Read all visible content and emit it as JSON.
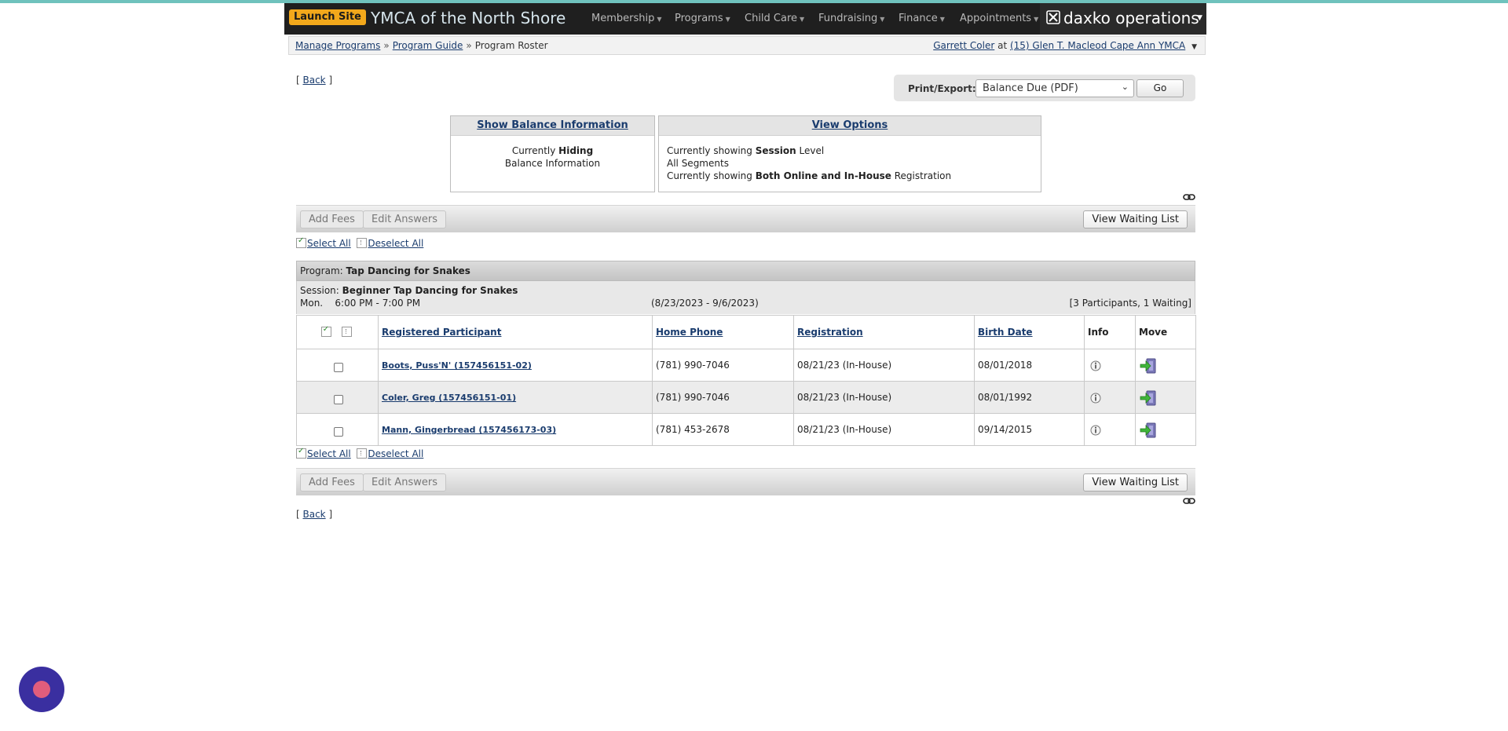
{
  "header": {
    "launch_label": "Launch Site",
    "org_name": "YMCA of the North Shore",
    "nav": [
      {
        "label": "Membership"
      },
      {
        "label": "Programs"
      },
      {
        "label": "Child Care"
      },
      {
        "label": "Fundraising"
      },
      {
        "label": "Finance"
      },
      {
        "label": "Appointments"
      }
    ],
    "brand": "daxko operations"
  },
  "breadcrumb": {
    "items": [
      "Manage Programs",
      "Program Guide",
      "Program Roster"
    ],
    "user_name": "Garrett Coler",
    "at_label": "at",
    "location": "(15) Glen T. Macleod Cape Ann YMCA"
  },
  "back_label": "Back",
  "export": {
    "label": "Print/Export:",
    "selected": "Balance Due (PDF)",
    "go_label": "Go"
  },
  "balance_box": {
    "title": "Show Balance Information",
    "line1_prefix": "Currently",
    "line1_bold": "Hiding",
    "line2": "Balance Information"
  },
  "view_options": {
    "title": "View Options",
    "line1_prefix": "Currently showing",
    "line1_bold": "Session",
    "line1_suffix": "Level",
    "line2": "All Segments",
    "line3_prefix": "Currently showing",
    "line3_bold": "Both Online and In-House",
    "line3_suffix": "Registration"
  },
  "toolbar": {
    "add_fees": "Add Fees",
    "edit_answers": "Edit Answers",
    "view_waiting": "View Waiting List"
  },
  "select_all": "Select All",
  "deselect_all": "Deselect All",
  "program": {
    "label": "Program:",
    "name": "Tap Dancing for Snakes"
  },
  "session": {
    "label": "Session:",
    "name": "Beginner Tap Dancing for Snakes",
    "day": "Mon.",
    "time": "6:00 PM - 7:00 PM",
    "dates": "(8/23/2023 - 9/6/2023)",
    "counts": "[3 Participants, 1 Waiting]"
  },
  "table": {
    "columns": {
      "participant": "Registered Participant",
      "phone": "Home Phone",
      "registration": "Registration",
      "birth": "Birth Date",
      "info": "Info",
      "move": "Move"
    },
    "rows": [
      {
        "name": "Boots, Puss'N' (157456151-02)",
        "phone": "(781) 990-7046",
        "registration": "08/21/23 (In-House)",
        "birth": "08/01/2018"
      },
      {
        "name": "Coler, Greg (157456151-01)",
        "phone": "(781) 990-7046",
        "registration": "08/21/23 (In-House)",
        "birth": "08/01/1992"
      },
      {
        "name": "Mann, Gingerbread (157456173-03)",
        "phone": "(781) 453-2678",
        "registration": "08/21/23 (In-House)",
        "birth": "09/14/2015"
      }
    ]
  }
}
